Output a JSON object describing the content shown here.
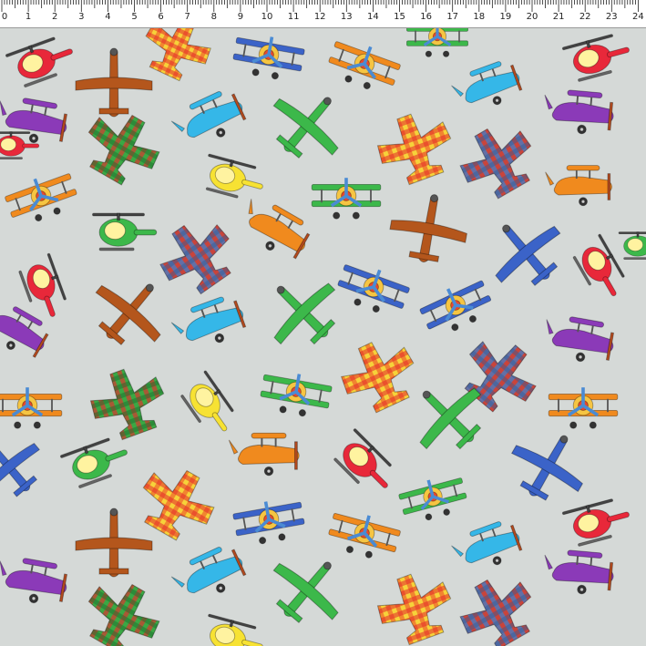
{
  "ruler": {
    "unit": "cm",
    "labels": [
      "0",
      "1",
      "2",
      "3",
      "4",
      "5",
      "6",
      "7",
      "8",
      "9",
      "10",
      "11",
      "12",
      "13",
      "14",
      "15",
      "16",
      "17",
      "18",
      "19",
      "20",
      "21",
      "22",
      "23",
      "24"
    ]
  },
  "colors": {
    "background": "#d5d9d7",
    "red": "#e8283a",
    "orange": "#f08a1e",
    "yellow": "#f7e233",
    "green": "#3cb84a",
    "teal": "#3fae6a",
    "blue": "#3b63c8",
    "cyan": "#35b7e8",
    "purple": "#8b3ab8",
    "brown": "#b4561c",
    "plaid_red": "#c9443b",
    "plaid_blue": "#4a7ac0"
  },
  "motifs": [
    {
      "kind": "helicopter",
      "color": "red",
      "label": "red helicopter"
    },
    {
      "kind": "monoplane",
      "color": "brown",
      "label": "brown plane"
    },
    {
      "kind": "plaid-plane",
      "color": "plaid_orange",
      "label": "orange plaid plane"
    },
    {
      "kind": "biplane-front",
      "color": "blue",
      "label": "blue biplane"
    },
    {
      "kind": "biplane-front",
      "color": "orange",
      "label": "orange biplane"
    },
    {
      "kind": "biplane-front",
      "color": "green",
      "label": "green biplane"
    },
    {
      "kind": "biplane-side",
      "color": "cyan",
      "label": "cyan biplane"
    },
    {
      "kind": "biplane-side",
      "color": "purple",
      "label": "purple biplane"
    },
    {
      "kind": "monoplane",
      "color": "green",
      "label": "green plane"
    },
    {
      "kind": "plaid-plane",
      "color": "plaid_green",
      "label": "green plaid plane"
    },
    {
      "kind": "plaid-plane",
      "color": "plaid_blue",
      "label": "blue plaid plane"
    },
    {
      "kind": "helicopter",
      "color": "yellow",
      "label": "yellow helicopter"
    },
    {
      "kind": "helicopter",
      "color": "green",
      "label": "green helicopter"
    },
    {
      "kind": "monoplane",
      "color": "blue",
      "label": "blue plane"
    },
    {
      "kind": "biplane-side",
      "color": "orange",
      "label": "orange side biplane"
    }
  ]
}
